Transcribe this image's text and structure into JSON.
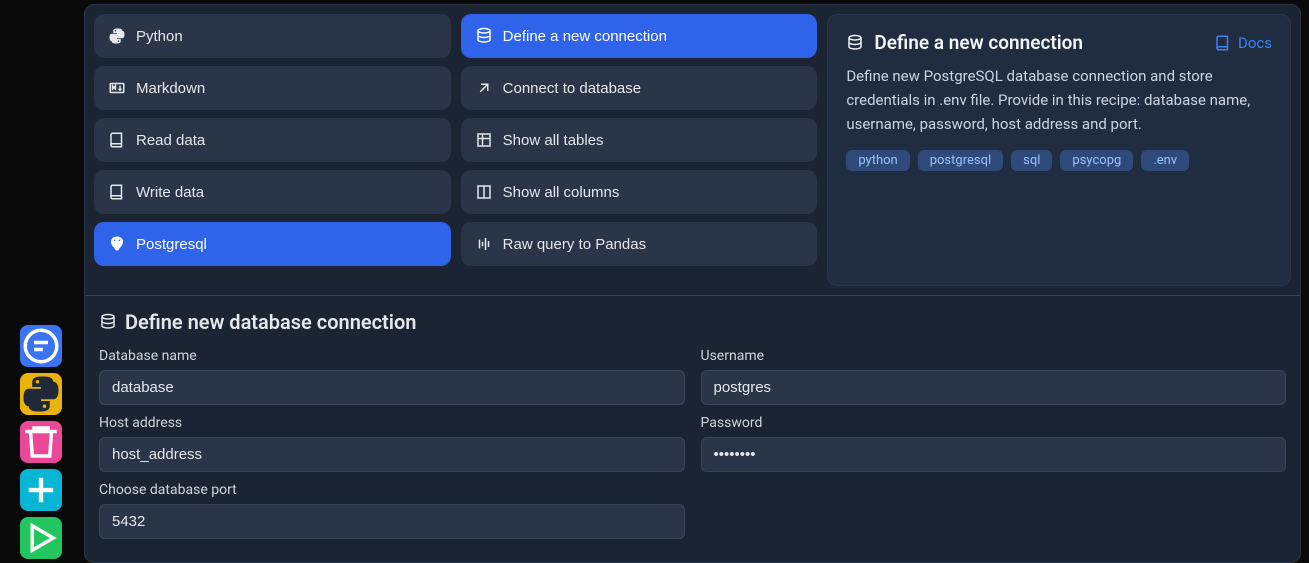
{
  "left_tools": [
    {
      "name": "chat-tool",
      "color": "blue",
      "icon": "chat"
    },
    {
      "name": "python-tool",
      "color": "yellow",
      "icon": "python"
    },
    {
      "name": "delete-tool",
      "color": "pink",
      "icon": "trash"
    },
    {
      "name": "add-tool",
      "color": "cyan",
      "icon": "plus"
    },
    {
      "name": "run-tool",
      "color": "green",
      "icon": "play"
    }
  ],
  "col1": [
    {
      "label": "Python",
      "icon": "python",
      "active": false
    },
    {
      "label": "Markdown",
      "icon": "markdown",
      "active": false
    },
    {
      "label": "Read data",
      "icon": "book",
      "active": false
    },
    {
      "label": "Write data",
      "icon": "book",
      "active": false
    },
    {
      "label": "Postgresql",
      "icon": "postgres",
      "active": true
    }
  ],
  "col2": [
    {
      "label": "Define a new connection",
      "icon": "database",
      "active": true
    },
    {
      "label": "Connect to database",
      "icon": "link",
      "active": false
    },
    {
      "label": "Show all tables",
      "icon": "table",
      "active": false
    },
    {
      "label": "Show all columns",
      "icon": "columns",
      "active": false
    },
    {
      "label": "Raw query to Pandas",
      "icon": "query",
      "active": false
    }
  ],
  "detail": {
    "title": "Define a new connection",
    "docs_label": "Docs",
    "description": "Define new PostgreSQL database connection and store credentials in .env file. Provide in this recipe: database name, username, password, host address and port.",
    "tags": [
      "python",
      "postgresql",
      "sql",
      "psycopg",
      ".env"
    ]
  },
  "form": {
    "title": "Define new database connection",
    "fields": {
      "db_name": {
        "label": "Database name",
        "value": "database"
      },
      "username": {
        "label": "Username",
        "value": "postgres"
      },
      "host": {
        "label": "Host address",
        "value": "host_address"
      },
      "password": {
        "label": "Password",
        "value": "••••••••"
      },
      "port": {
        "label": "Choose database port",
        "value": "5432"
      }
    }
  }
}
